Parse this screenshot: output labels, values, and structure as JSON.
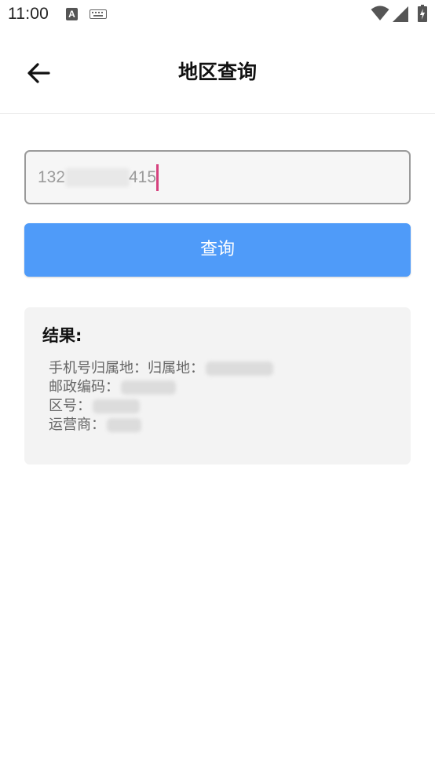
{
  "status_bar": {
    "time": "11:00",
    "notification_letter": "A"
  },
  "app_bar": {
    "title": "地区查询"
  },
  "phone_input": {
    "value_start": "132",
    "value_end": "415"
  },
  "query_button": {
    "label": "查询"
  },
  "result": {
    "title": "结果:",
    "lines": [
      {
        "label": "手机号归属地：归属地："
      },
      {
        "label": "邮政编码："
      },
      {
        "label": "区号："
      },
      {
        "label": "运营商："
      }
    ]
  },
  "colors": {
    "accent": "#4f9bf9",
    "caret": "#d6417e",
    "card_bg": "#f3f3f3"
  }
}
